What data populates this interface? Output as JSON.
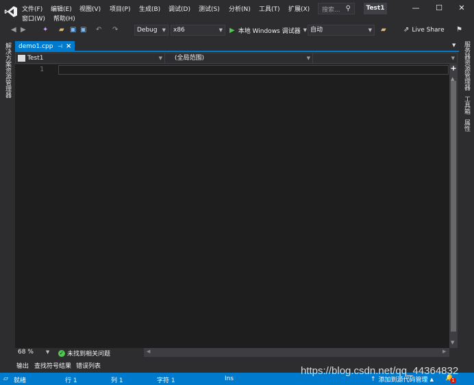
{
  "title_bar": {
    "menu_row1": [
      "文件(F)",
      "编辑(E)",
      "视图(V)",
      "项目(P)",
      "生成(B)",
      "调试(D)",
      "测试(S)",
      "分析(N)",
      "工具(T)",
      "扩展(X)"
    ],
    "menu_row2": [
      "窗口(W)",
      "帮助(H)"
    ],
    "search_placeholder": "搜索...",
    "solution_name": "Test1",
    "window_buttons": [
      "—",
      "☐",
      "✕"
    ]
  },
  "toolbar": {
    "configuration": "Debug",
    "platform": "x86",
    "start_label": "本地 Windows 调试器",
    "start_mode": "自动",
    "live_share": "Live Share"
  },
  "side_panels": {
    "left": "解决方案资源管理器",
    "right": [
      "服务器资源管理器",
      "工具箱",
      "属性"
    ]
  },
  "document_tab": {
    "filename": "demo1.cpp",
    "pin_icon": "pin-icon",
    "close_icon": "close-icon"
  },
  "nav_bar": {
    "project": "Test1",
    "scope": "(全局范围)",
    "member": ""
  },
  "editor": {
    "line_numbers": [
      "1"
    ],
    "zoom": "68 %",
    "issues_status": "未找到相关问题"
  },
  "tool_tabs": [
    "输出",
    "查找符号结果",
    "错误列表"
  ],
  "status_bar": {
    "state": "就绪",
    "line": "行 1",
    "col": "列 1",
    "char": "字符 1",
    "ins": "Ins",
    "source_control": "添加到源代码管理",
    "notification_count": "1"
  },
  "watermark": "https://blog.csdn.net/qq_44364832",
  "colors": {
    "accent": "#007acc",
    "editor_bg": "#1e1e1e",
    "chrome_bg": "#2d2d30",
    "line_number": "#2b91af"
  }
}
